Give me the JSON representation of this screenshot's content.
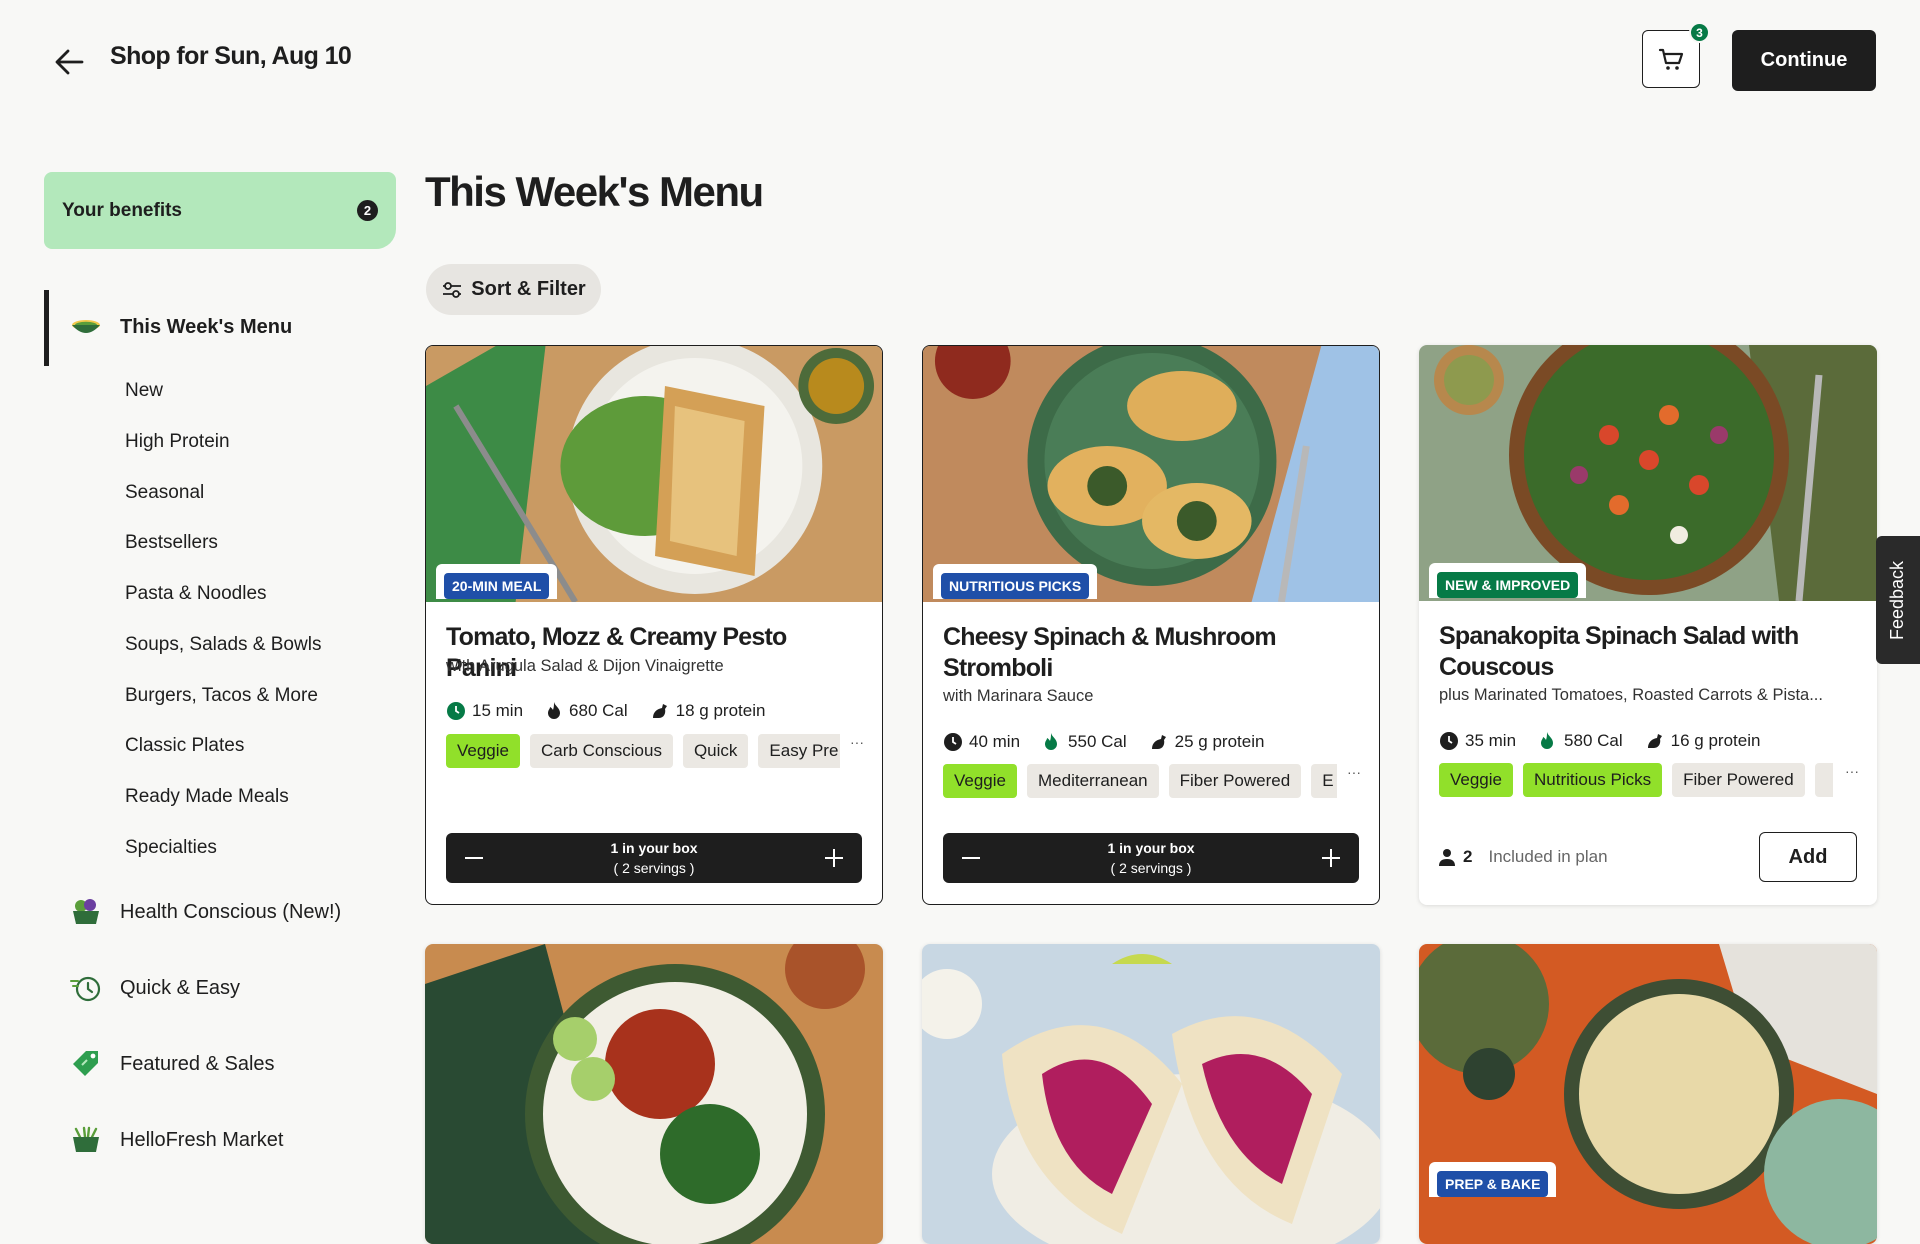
{
  "header": {
    "title": "Shop for Sun, Aug 10",
    "cart_count": "3",
    "continue_label": "Continue"
  },
  "sidebar": {
    "benefits_label": "Your benefits",
    "benefits_count": "2",
    "active_label": "This Week's Menu",
    "sub_items": [
      "New",
      "High Protein",
      "Seasonal",
      "Bestsellers",
      "Pasta & Noodles",
      "Soups, Salads & Bowls",
      "Burgers, Tacos & More",
      "Classic Plates",
      "Ready Made Meals",
      "Specialties"
    ],
    "sections": [
      "Health Conscious (New!)",
      "Quick & Easy",
      "Featured & Sales",
      "HelloFresh Market"
    ]
  },
  "main": {
    "title": "This Week's Menu",
    "sort_label": "Sort & Filter"
  },
  "cards": [
    {
      "badge": "20-MIN MEAL",
      "badge_color": "#1f4fa8",
      "name": "Tomato, Mozz & Creamy Pesto Panini",
      "subtitle": "with Arugula Salad & Dijon Vinaigrette",
      "time": "15 min",
      "calories": "680 Cal",
      "protein": "18 g protein",
      "tags": [
        "Veggie",
        "Carb Conscious",
        "Quick",
        "Easy Pre"
      ],
      "in_box": "1 in your box",
      "servings": "( 2 servings )"
    },
    {
      "badge": "NUTRITIOUS PICKS",
      "badge_color": "#1f4fa8",
      "name": "Cheesy Spinach & Mushroom Stromboli",
      "subtitle": "with Marinara Sauce",
      "time": "40 min",
      "calories": "550 Cal",
      "protein": "25 g protein",
      "tags": [
        "Veggie",
        "Mediterranean",
        "Fiber Powered",
        "E"
      ],
      "in_box": "1 in your box",
      "servings": "( 2 servings )"
    },
    {
      "badge": "NEW & IMPROVED",
      "badge_color": "#067a46",
      "name": "Spanakopita Spinach Salad with Couscous",
      "subtitle": "plus Marinated Tomatoes, Roasted Carrots & Pista...",
      "time": "35 min",
      "calories": "580 Cal",
      "protein": "16 g protein",
      "tags": [
        "Veggie",
        "Nutritious Picks",
        "Fiber Powered"
      ],
      "servings_count": "2",
      "plan_text": "Included in plan",
      "add_label": "Add"
    },
    {
      "badge": ""
    },
    {
      "badge": ""
    },
    {
      "badge": "PREP & BAKE",
      "badge_color": "#1f4fa8"
    }
  ],
  "feedback_label": "Feedback"
}
